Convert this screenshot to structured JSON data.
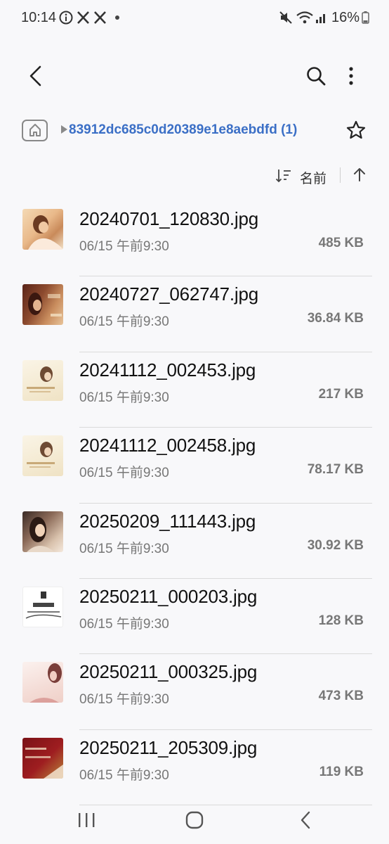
{
  "status_bar": {
    "time": "10:14",
    "battery": "16%",
    "notification_icons": [
      "info-icon",
      "x-logo-icon",
      "x-logo-icon",
      "dot-icon"
    ],
    "system_icons": [
      "mute-icon",
      "wifi-icon",
      "signal-icon",
      "battery-icon"
    ]
  },
  "toolbar": {
    "back_icon": "back-arrow-icon",
    "search_icon": "search-icon",
    "more_icon": "more-vert-icon"
  },
  "path": {
    "home_icon": "home-folder-icon",
    "folder_name": "83912dc685c0d20389e1e8aebdfd (1)",
    "favorite_icon": "star-outline-icon"
  },
  "sort": {
    "label": "名前",
    "sort_icon": "sort-icon",
    "direction_icon": "arrow-up-icon"
  },
  "files": [
    {
      "name": "20240701_120830.jpg",
      "date": "06/15 午前9:30",
      "size": "485 KB"
    },
    {
      "name": "20240727_062747.jpg",
      "date": "06/15 午前9:30",
      "size": "36.84 KB"
    },
    {
      "name": "20241112_002453.jpg",
      "date": "06/15 午前9:30",
      "size": "217 KB"
    },
    {
      "name": "20241112_002458.jpg",
      "date": "06/15 午前9:30",
      "size": "78.17 KB"
    },
    {
      "name": "20250209_111443.jpg",
      "date": "06/15 午前9:30",
      "size": "30.92 KB"
    },
    {
      "name": "20250211_000203.jpg",
      "date": "06/15 午前9:30",
      "size": "128 KB"
    },
    {
      "name": "20250211_000325.jpg",
      "date": "06/15 午前9:30",
      "size": "473 KB"
    },
    {
      "name": "20250211_205309.jpg",
      "date": "06/15 午前9:30",
      "size": "119 KB"
    }
  ],
  "nav_bar": {
    "recents_icon": "recents-icon",
    "home_icon": "home-button-icon",
    "back_icon": "nav-back-icon"
  },
  "colors": {
    "path_text": "#3b6fc6",
    "background": "#f8f8fa"
  }
}
